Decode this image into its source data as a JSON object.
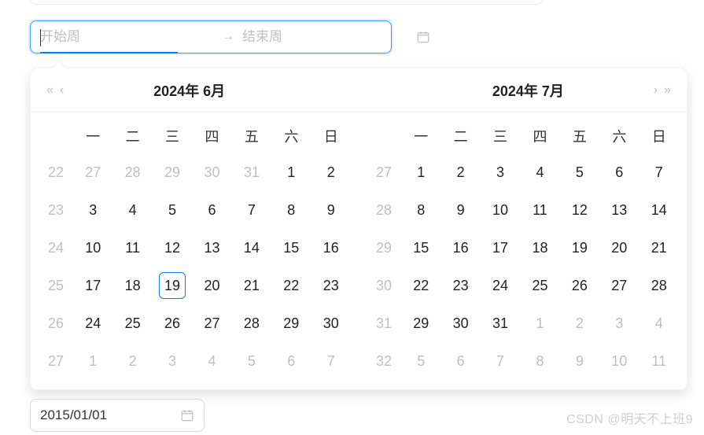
{
  "rangePicker": {
    "start_placeholder": "开始周",
    "end_placeholder": "结束周"
  },
  "calendar": {
    "left": {
      "title": "2024年  6月",
      "weekdays": [
        "一",
        "二",
        "三",
        "四",
        "五",
        "六",
        "日"
      ],
      "rows": [
        {
          "wk": "22",
          "days": [
            {
              "d": "27",
              "o": true
            },
            {
              "d": "28",
              "o": true
            },
            {
              "d": "29",
              "o": true
            },
            {
              "d": "30",
              "o": true
            },
            {
              "d": "31",
              "o": true
            },
            {
              "d": "1"
            },
            {
              "d": "2"
            }
          ]
        },
        {
          "wk": "23",
          "days": [
            {
              "d": "3"
            },
            {
              "d": "4"
            },
            {
              "d": "5"
            },
            {
              "d": "6"
            },
            {
              "d": "7"
            },
            {
              "d": "8"
            },
            {
              "d": "9"
            }
          ]
        },
        {
          "wk": "24",
          "days": [
            {
              "d": "10"
            },
            {
              "d": "11"
            },
            {
              "d": "12"
            },
            {
              "d": "13"
            },
            {
              "d": "14"
            },
            {
              "d": "15"
            },
            {
              "d": "16"
            }
          ]
        },
        {
          "wk": "25",
          "days": [
            {
              "d": "17"
            },
            {
              "d": "18"
            },
            {
              "d": "19",
              "today": true
            },
            {
              "d": "20"
            },
            {
              "d": "21"
            },
            {
              "d": "22"
            },
            {
              "d": "23"
            }
          ]
        },
        {
          "wk": "26",
          "days": [
            {
              "d": "24"
            },
            {
              "d": "25"
            },
            {
              "d": "26"
            },
            {
              "d": "27"
            },
            {
              "d": "28"
            },
            {
              "d": "29"
            },
            {
              "d": "30"
            }
          ]
        },
        {
          "wk": "27",
          "days": [
            {
              "d": "1",
              "o": true
            },
            {
              "d": "2",
              "o": true
            },
            {
              "d": "3",
              "o": true
            },
            {
              "d": "4",
              "o": true
            },
            {
              "d": "5",
              "o": true
            },
            {
              "d": "6",
              "o": true
            },
            {
              "d": "7",
              "o": true
            }
          ]
        }
      ]
    },
    "right": {
      "title": "2024年  7月",
      "weekdays": [
        "一",
        "二",
        "三",
        "四",
        "五",
        "六",
        "日"
      ],
      "rows": [
        {
          "wk": "27",
          "days": [
            {
              "d": "1"
            },
            {
              "d": "2"
            },
            {
              "d": "3"
            },
            {
              "d": "4"
            },
            {
              "d": "5"
            },
            {
              "d": "6"
            },
            {
              "d": "7"
            }
          ]
        },
        {
          "wk": "28",
          "days": [
            {
              "d": "8"
            },
            {
              "d": "9"
            },
            {
              "d": "10"
            },
            {
              "d": "11"
            },
            {
              "d": "12"
            },
            {
              "d": "13"
            },
            {
              "d": "14"
            }
          ]
        },
        {
          "wk": "29",
          "days": [
            {
              "d": "15"
            },
            {
              "d": "16"
            },
            {
              "d": "17"
            },
            {
              "d": "18"
            },
            {
              "d": "19"
            },
            {
              "d": "20"
            },
            {
              "d": "21"
            }
          ]
        },
        {
          "wk": "30",
          "days": [
            {
              "d": "22"
            },
            {
              "d": "23"
            },
            {
              "d": "24"
            },
            {
              "d": "25"
            },
            {
              "d": "26"
            },
            {
              "d": "27"
            },
            {
              "d": "28"
            }
          ]
        },
        {
          "wk": "31",
          "days": [
            {
              "d": "29"
            },
            {
              "d": "30"
            },
            {
              "d": "31"
            },
            {
              "d": "1",
              "o": true
            },
            {
              "d": "2",
              "o": true
            },
            {
              "d": "3",
              "o": true
            },
            {
              "d": "4",
              "o": true
            }
          ]
        },
        {
          "wk": "32",
          "days": [
            {
              "d": "5",
              "o": true
            },
            {
              "d": "6",
              "o": true
            },
            {
              "d": "7",
              "o": true
            },
            {
              "d": "8",
              "o": true
            },
            {
              "d": "9",
              "o": true
            },
            {
              "d": "10",
              "o": true
            },
            {
              "d": "11",
              "o": true
            }
          ]
        }
      ]
    }
  },
  "bottomPicker": {
    "value": "2015/01/01"
  },
  "watermark": "CSDN @明天不上班9"
}
